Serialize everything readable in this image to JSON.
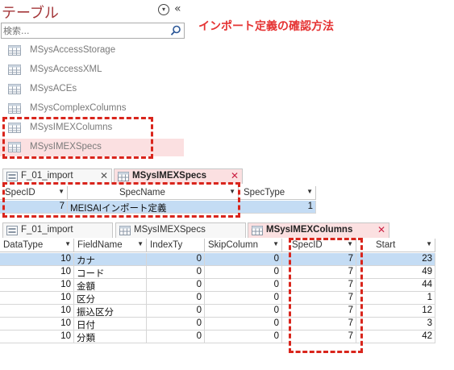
{
  "nav": {
    "title": "テーブル",
    "ctrl_circle": "▾",
    "ctrl_collapse": "«",
    "search_placeholder": "検索...",
    "items": [
      {
        "label": "MSysAccessStorage"
      },
      {
        "label": "MSysAccessXML"
      },
      {
        "label": "MSysACEs"
      },
      {
        "label": "MSysComplexColumns"
      },
      {
        "label": "MSysIMEXColumns"
      },
      {
        "label": "MSysIMEXSpecs"
      }
    ]
  },
  "callout": "インポート定義の確認方法",
  "tabs_top": [
    {
      "label": "F_01_import",
      "close": "✕"
    },
    {
      "label": "MSysIMEXSpecs",
      "close": "✕"
    }
  ],
  "specs_table": {
    "columns": [
      "SpecID",
      "SpecName",
      "SpecType"
    ],
    "rows": [
      {
        "SpecID": "7",
        "SpecName": "MEISAIインポート定義",
        "SpecType": "1"
      }
    ]
  },
  "tabs_bottom": [
    {
      "label": "F_01_import"
    },
    {
      "label": "MSysIMEXSpecs"
    },
    {
      "label": "MSysIMEXColumns",
      "close": "✕"
    }
  ],
  "columns_table": {
    "columns": [
      "DataType",
      "FieldName",
      "IndexTy",
      "SkipColumn",
      "SpecID",
      "Start"
    ],
    "rows": [
      {
        "DataType": "10",
        "FieldName": "カナ",
        "IndexTy": "0",
        "SkipColumn": "0",
        "SpecID": "7",
        "Start": "23"
      },
      {
        "DataType": "10",
        "FieldName": "コード",
        "IndexTy": "0",
        "SkipColumn": "0",
        "SpecID": "7",
        "Start": "49"
      },
      {
        "DataType": "10",
        "FieldName": "金額",
        "IndexTy": "0",
        "SkipColumn": "0",
        "SpecID": "7",
        "Start": "44"
      },
      {
        "DataType": "10",
        "FieldName": "区分",
        "IndexTy": "0",
        "SkipColumn": "0",
        "SpecID": "7",
        "Start": "1"
      },
      {
        "DataType": "10",
        "FieldName": "振込区分",
        "IndexTy": "0",
        "SkipColumn": "0",
        "SpecID": "7",
        "Start": "12"
      },
      {
        "DataType": "10",
        "FieldName": "日付",
        "IndexTy": "0",
        "SkipColumn": "0",
        "SpecID": "7",
        "Start": "3"
      },
      {
        "DataType": "10",
        "FieldName": "分類",
        "IndexTy": "0",
        "SkipColumn": "0",
        "SpecID": "7",
        "Start": "42"
      }
    ]
  },
  "colors": {
    "accent": "#a4373a",
    "highlight": "#d9251c",
    "selected_row": "#c4dcf4",
    "active_tab": "#fbe0e1"
  }
}
